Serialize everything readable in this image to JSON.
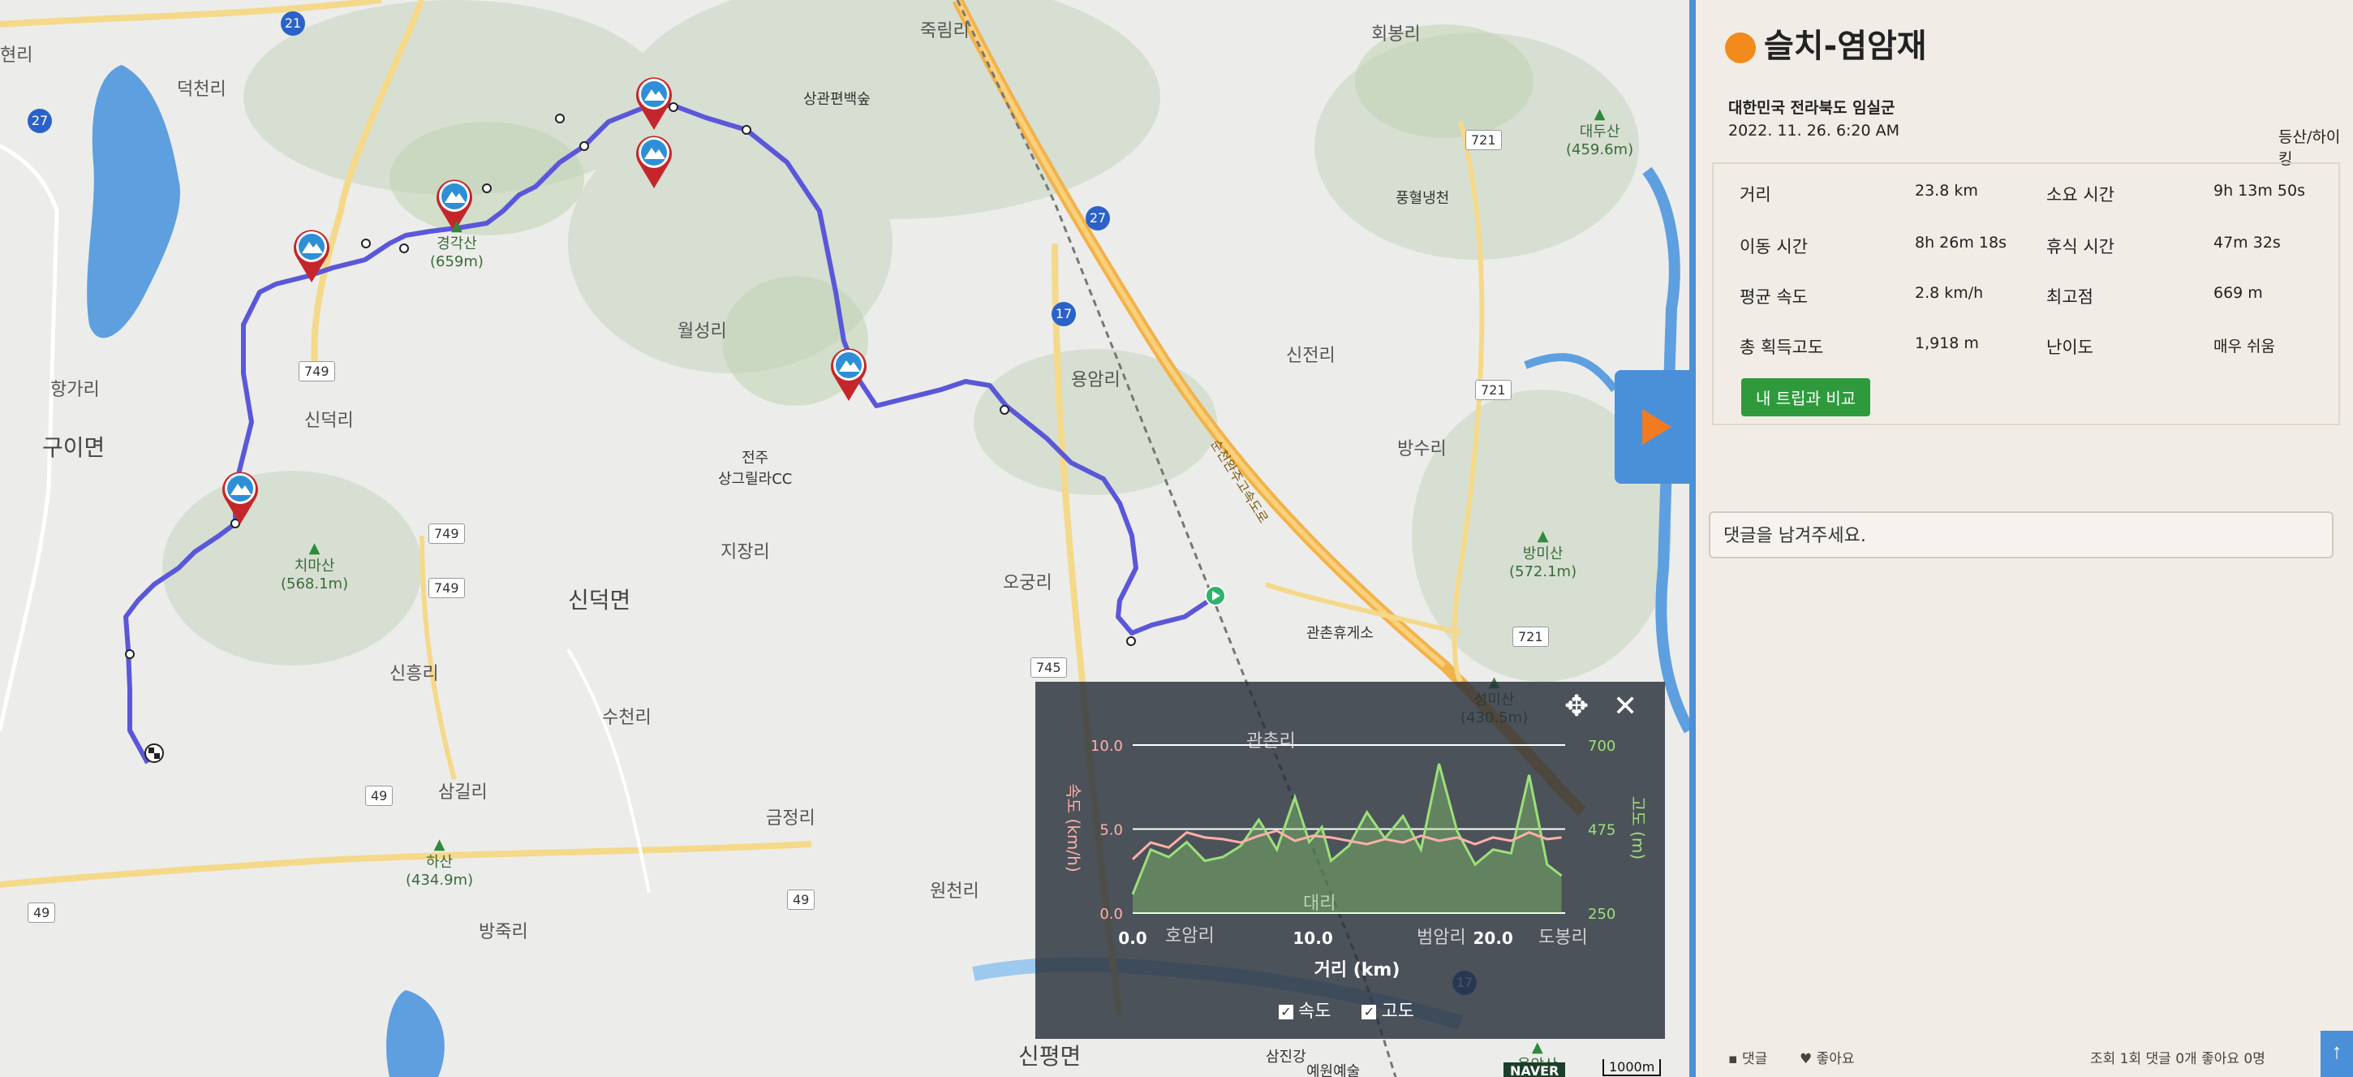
{
  "map": {
    "labels": [
      {
        "text": "현리",
        "cls": ""
      },
      {
        "text": "덕천리",
        "cls": ""
      },
      {
        "text": "항가리",
        "cls": ""
      },
      {
        "text": "구이면",
        "cls": "big"
      },
      {
        "text": "신덕리",
        "cls": ""
      },
      {
        "text": "월성리",
        "cls": ""
      },
      {
        "text": "지장리",
        "cls": ""
      },
      {
        "text": "신덕면",
        "cls": "big"
      },
      {
        "text": "오궁리",
        "cls": ""
      },
      {
        "text": "신흥리",
        "cls": ""
      },
      {
        "text": "수천리",
        "cls": ""
      },
      {
        "text": "삼길리",
        "cls": ""
      },
      {
        "text": "금정리",
        "cls": ""
      },
      {
        "text": "원천리",
        "cls": ""
      },
      {
        "text": "방죽리",
        "cls": ""
      },
      {
        "text": "죽림리",
        "cls": ""
      },
      {
        "text": "회봉리",
        "cls": ""
      },
      {
        "text": "용암리",
        "cls": ""
      },
      {
        "text": "신전리",
        "cls": ""
      },
      {
        "text": "방수리",
        "cls": ""
      },
      {
        "text": "상관편백숲",
        "cls": "poi"
      },
      {
        "text": "풍혈냉천",
        "cls": "poi"
      },
      {
        "text": "관촌휴게소",
        "cls": "poi"
      },
      {
        "text": "전주\n상그릴라CC",
        "cls": "poi"
      },
      {
        "text": "삼진강",
        "cls": "poi"
      },
      {
        "text": "예원예술",
        "cls": "poi"
      },
      {
        "text": "신평면",
        "cls": "big"
      }
    ],
    "peaks": [
      {
        "name": "경각산",
        "height": "(659m)"
      },
      {
        "name": "치마산",
        "height": "(568.1m)"
      },
      {
        "name": "하산",
        "height": "(434.9m)"
      },
      {
        "name": "대두산",
        "height": "(459.6m)"
      },
      {
        "name": "방미산",
        "height": "(572.1m)"
      },
      {
        "name": "성미산",
        "height": "(430.5m)"
      },
      {
        "name": "용암산",
        "height": ""
      }
    ],
    "shields": [
      "21",
      "27",
      "749",
      "749",
      "749",
      "745",
      "49",
      "49",
      "49",
      "17",
      "27",
      "721",
      "721",
      "721",
      "17"
    ],
    "highway_label": "순천완주고속도로",
    "naver": "NAVER",
    "scale": "1000m"
  },
  "chart": {
    "left_ticks": [
      "10.0",
      "5.0",
      "0.0"
    ],
    "right_ticks": [
      "700",
      "475",
      "250"
    ],
    "x_ticks": [
      "0.0",
      "10.0",
      "20.0"
    ],
    "left_axis": "속도 (km/h)",
    "right_axis": "고도 (m)",
    "x_axis": "거리 (km)",
    "legend_speed": "속도",
    "legend_alt": "고도",
    "checkmark": "✓",
    "move_icon": "✥",
    "close_icon": "✕",
    "bg_labels": [
      "관촌리",
      "호암리",
      "대리",
      "범암리",
      "도봉리"
    ],
    "speed_color": "#ffb0a8",
    "alt_color": "#9ce07a"
  },
  "chart_data": {
    "type": "line",
    "xlabel": "거리 (km)",
    "ylabel": "속도 (km/h)",
    "y2label": "고도 (m)",
    "xlim": [
      0,
      24
    ],
    "ylim": [
      0,
      10
    ],
    "y2lim": [
      250,
      700
    ],
    "series": [
      {
        "name": "속도",
        "axis": "left",
        "x": [
          0,
          1,
          2,
          3,
          4,
          5,
          6,
          7,
          8,
          9,
          10,
          11,
          12,
          13,
          14,
          15,
          16,
          17,
          18,
          19,
          20,
          21,
          22,
          23,
          23.8
        ],
        "values": [
          3.2,
          4.2,
          3.9,
          4.8,
          4.5,
          4.4,
          4.2,
          4.6,
          4.9,
          4.3,
          4.6,
          4.5,
          4.3,
          4.1,
          4.4,
          4.2,
          4.6,
          4.3,
          4.5,
          4.1,
          4.5,
          4.3,
          4.8,
          4.4,
          4.5
        ]
      },
      {
        "name": "고도",
        "axis": "right",
        "x": [
          0,
          1,
          2,
          3,
          4,
          5,
          6,
          7,
          8,
          9,
          9.8,
          10.5,
          11,
          12,
          13,
          14,
          15,
          16,
          17,
          18,
          19,
          20,
          21,
          22,
          23,
          23.8
        ],
        "values": [
          300,
          420,
          400,
          440,
          390,
          400,
          430,
          500,
          420,
          560,
          440,
          480,
          390,
          430,
          520,
          450,
          510,
          420,
          650,
          470,
          380,
          420,
          410,
          620,
          380,
          350
        ]
      }
    ]
  },
  "panel": {
    "title": "슬치-염암재",
    "location": "대한민국 전라북도 임실군",
    "date": "2022. 11. 26. 6:20 AM",
    "category": "등산/하이킹",
    "stats": [
      {
        "label": "거리",
        "value": "23.8 km"
      },
      {
        "label": "소요 시간",
        "value": "9h 13m 50s"
      },
      {
        "label": "이동 시간",
        "value": "8h 26m 18s"
      },
      {
        "label": "휴식 시간",
        "value": "47m 32s"
      },
      {
        "label": "평균 속도",
        "value": "2.8 km/h"
      },
      {
        "label": "최고점",
        "value": "669 m"
      },
      {
        "label": "총 획득고도",
        "value": "1,918 m"
      },
      {
        "label": "난이도",
        "value": "매우 쉬움"
      }
    ],
    "compare_button": "내 트립과 비교",
    "comment_placeholder": "댓글을 남겨주세요.",
    "footer_comments": "댓글",
    "footer_likes": "좋아요",
    "footer_stats": "조회 1회  댓글 0개  좋아요 0명"
  }
}
